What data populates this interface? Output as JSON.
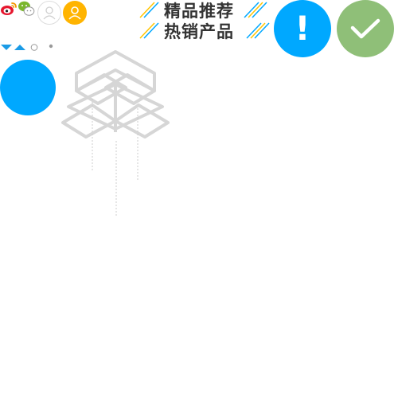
{
  "sprites": {
    "social": {
      "weibo_icon": "weibo-icon",
      "wechat_icon": "wechat-icon"
    },
    "avatars": {
      "outline_color": "#dddddd",
      "filled_color": "#ffb400"
    },
    "headings": {
      "featured": "精品推荐",
      "bestseller": "热销产品",
      "stripe_colors": [
        "#ffc400",
        "#00a8ff"
      ]
    },
    "status": {
      "alert_color": "#00a8ff",
      "alert_mark": "!",
      "success_color": "#8fbf78"
    },
    "indicators": {
      "arrow_color": "#1a9be6",
      "dot_color": "#999999"
    },
    "blue_circle_color": "#00a8ff",
    "empty_box": {
      "stroke_color": "#d6d6d6"
    }
  }
}
